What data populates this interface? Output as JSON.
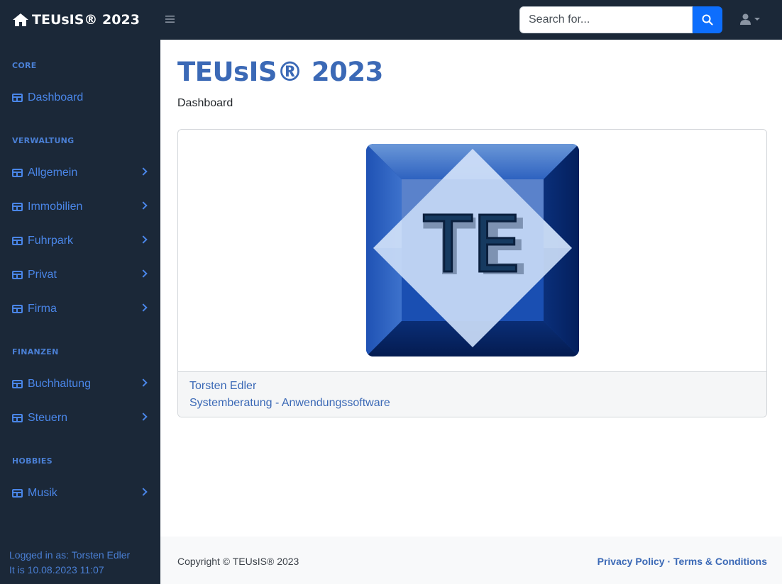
{
  "navbar": {
    "brand": "TEUsIS® 2023",
    "search_placeholder": "Search for...",
    "search_value": ""
  },
  "sidebar": {
    "sections": [
      {
        "heading": "CORE",
        "items": [
          {
            "label": "Dashboard",
            "has_submenu": false
          }
        ]
      },
      {
        "heading": "VERWALTUNG",
        "items": [
          {
            "label": "Allgemein",
            "has_submenu": true
          },
          {
            "label": "Immobilien",
            "has_submenu": true
          },
          {
            "label": "Fuhrpark",
            "has_submenu": true
          },
          {
            "label": "Privat",
            "has_submenu": true
          },
          {
            "label": "Firma",
            "has_submenu": true
          }
        ]
      },
      {
        "heading": "FINANZEN",
        "items": [
          {
            "label": "Buchhaltung",
            "has_submenu": true
          },
          {
            "label": "Steuern",
            "has_submenu": true
          }
        ]
      },
      {
        "heading": "HOBBIES",
        "items": [
          {
            "label": "Musik",
            "has_submenu": true
          }
        ]
      }
    ],
    "footer": {
      "logged_in": "Logged in as: Torsten Edler",
      "datetime": "It is 10.08.2023 11:07"
    }
  },
  "main": {
    "title": "TEUsIS® 2023",
    "breadcrumb": "Dashboard",
    "card": {
      "logo_text": "TE",
      "footer_name": "Torsten Edler",
      "footer_subtitle": "Systemberatung - Anwendungssoftware"
    }
  },
  "footer": {
    "copyright": "Copyright © TEUsIS® 2023",
    "separator": "·",
    "privacy": "Privacy Policy",
    "terms": "Terms & Conditions"
  },
  "colors": {
    "nav_bg": "#1b2838",
    "accent": "#4a86e8",
    "title": "#3b69b6",
    "search_button": "#0d6efd"
  },
  "icons": [
    "home-icon",
    "hamburger-icon",
    "search-icon",
    "user-icon",
    "table-icon",
    "chevron-right-icon"
  ]
}
